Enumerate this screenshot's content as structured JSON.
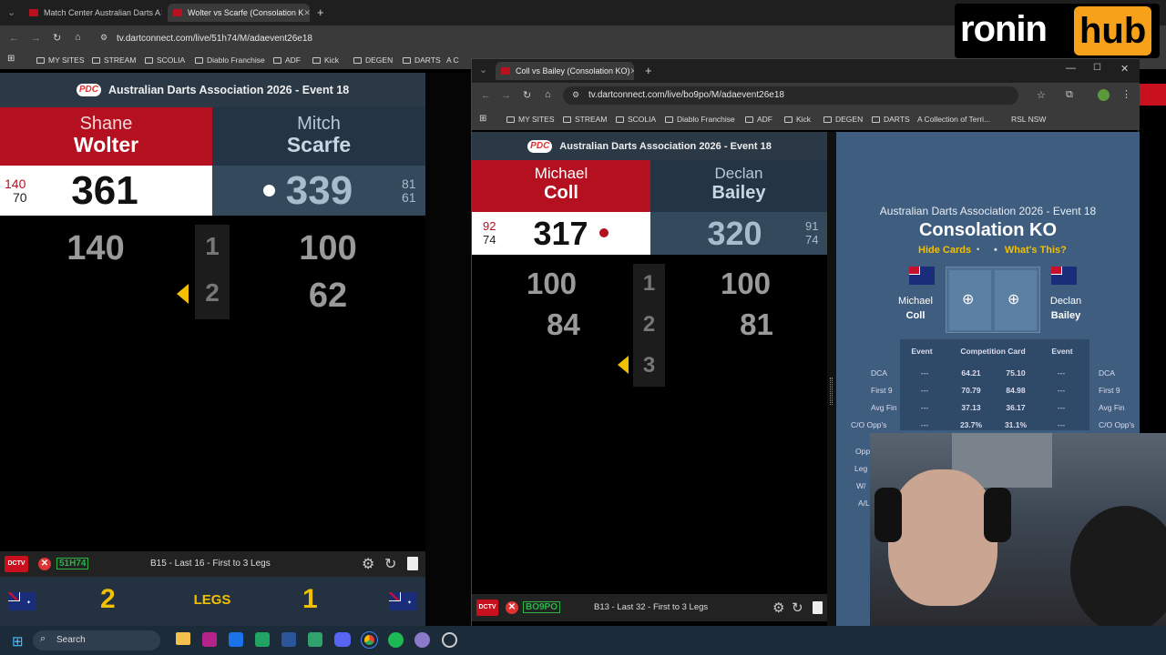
{
  "browser_back": {
    "tabs": [
      {
        "label": "Match Center Australian Darts A"
      },
      {
        "label": "Wolter vs Scarfe (Consolation K"
      }
    ],
    "url": "tv.dartconnect.com/live/51h74/M/adaevent26e18",
    "bookmarks": [
      "MY SITES",
      "STREAM",
      "SCOLIA",
      "Diablo Franchise",
      "ADF",
      "Kick",
      "DEGEN",
      "DARTS",
      "A C"
    ]
  },
  "browser_front": {
    "tab_label": "Coll vs Bailey (Consolation KO)",
    "url": "tv.dartconnect.com/live/bo9po/M/adaevent26e18",
    "bookmarks": [
      "MY SITES",
      "STREAM",
      "SCOLIA",
      "Diablo Franchise",
      "ADF",
      "Kick",
      "DEGEN",
      "DARTS",
      "A Collection of Terri...",
      "RSL NSW"
    ]
  },
  "logo": {
    "ronin": "ronin",
    "hub": "hub"
  },
  "match1": {
    "pdc": "PDC",
    "event_title": "Australian Darts Association 2026 - Event 18",
    "p1": {
      "first": "Shane",
      "last": "Wolter",
      "score": "361",
      "stat_top": "140",
      "stat_bottom": "70",
      "legs_won": "2"
    },
    "p2": {
      "first": "Mitch",
      "last": "Scarfe",
      "score": "339",
      "stat_top": "81",
      "stat_bottom": "61",
      "legs_won": "1"
    },
    "rows": [
      {
        "p1": "140",
        "leg": "1",
        "p2": "100"
      },
      {
        "p1": "",
        "leg": "2",
        "p2": "62"
      }
    ],
    "code": "51H74",
    "board_info": "B15 - Last 16 - First to 3 Legs",
    "legs_label": "LEGS"
  },
  "match2": {
    "pdc": "PDC",
    "event_title": "Australian Darts Association 2026 - Event 18",
    "p1": {
      "first": "Michael",
      "last": "Coll",
      "score": "317",
      "stat_top": "92",
      "stat_bottom": "74"
    },
    "p2": {
      "first": "Declan",
      "last": "Bailey",
      "score": "320",
      "stat_top": "91",
      "stat_bottom": "74"
    },
    "rows": [
      {
        "p1": "100",
        "leg": "1",
        "p2": "100"
      },
      {
        "p1": "84",
        "leg": "2",
        "p2": "81"
      },
      {
        "p1": "",
        "leg": "3",
        "p2": ""
      }
    ],
    "code": "BO9PO",
    "board_info": "B13 - Last 32 - First to 3 Legs"
  },
  "panel": {
    "event_title": "Australian Darts Association 2026 - Event 18",
    "stage": "Consolation KO",
    "hide_cards": "Hide Cards",
    "whats_this": "What's This?",
    "p1_first": "Michael",
    "p1_last": "Coll",
    "p2_first": "Declan",
    "p2_last": "Bailey",
    "col_event": "Event",
    "col_card": "Competition Card",
    "stats": [
      {
        "label": "DCA",
        "e1": "---",
        "c1": "64.21",
        "c2": "75.10",
        "e2": "---"
      },
      {
        "label": "First 9",
        "e1": "---",
        "c1": "70.79",
        "c2": "84.98",
        "e2": "---"
      },
      {
        "label": "Avg Fin",
        "e1": "---",
        "c1": "37.13",
        "c2": "36.17",
        "e2": "---"
      },
      {
        "label": "C/O Opp's",
        "e1": "---",
        "c1": "23.7%",
        "c2": "31.1%",
        "e2": "---"
      }
    ],
    "more_labels": [
      "Opp",
      "Leg",
      "W/",
      "A/L"
    ]
  },
  "taskbar": {
    "search": "Search"
  }
}
